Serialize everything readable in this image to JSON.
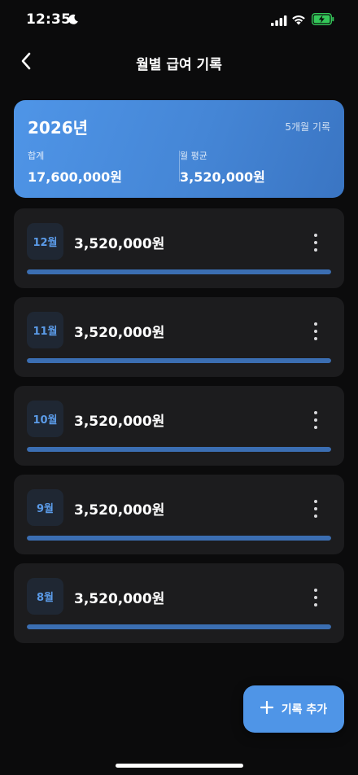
{
  "status_bar": {
    "time": "12:35",
    "icons": [
      "moon-icon",
      "signal-icon",
      "wifi-icon",
      "battery-charging-icon"
    ]
  },
  "nav": {
    "title": "월별 급여 기록",
    "back_icon": "chevron-left-icon"
  },
  "summary": {
    "year": "2026년",
    "count_label": "5개월 기록",
    "total_label": "합계",
    "total_value": "17,600,000원",
    "average_label": "월 평균",
    "average_value": "3,520,000원"
  },
  "months": [
    {
      "label": "12월",
      "amount": "3,520,000원",
      "progress_percent": 100
    },
    {
      "label": "11월",
      "amount": "3,520,000원",
      "progress_percent": 100
    },
    {
      "label": "10월",
      "amount": "3,520,000원",
      "progress_percent": 100
    },
    {
      "label": "9월",
      "amount": "3,520,000원",
      "progress_percent": 100
    },
    {
      "label": "8월",
      "amount": "3,520,000원",
      "progress_percent": 100
    }
  ],
  "fab": {
    "label": "기록 추가",
    "icon": "plus-icon"
  },
  "colors": {
    "background": "#0b0b0c",
    "card": "#1c1c1e",
    "accent": "#4f95e7",
    "progress": "#3b6eb2",
    "badge_text": "#5b9be8",
    "battery_green": "#34c759"
  }
}
